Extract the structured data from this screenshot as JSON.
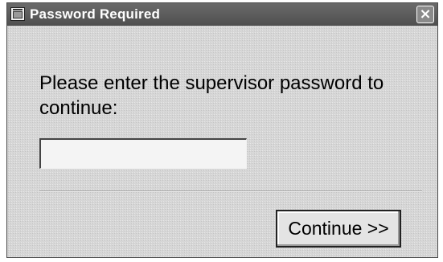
{
  "window": {
    "title": "Password Required",
    "close_symbol": "×",
    "icon": "app-window-icon"
  },
  "main": {
    "prompt": "Please enter the supervisor password to continue:",
    "password_value": ""
  },
  "buttons": {
    "continue_label": "Continue >>"
  }
}
